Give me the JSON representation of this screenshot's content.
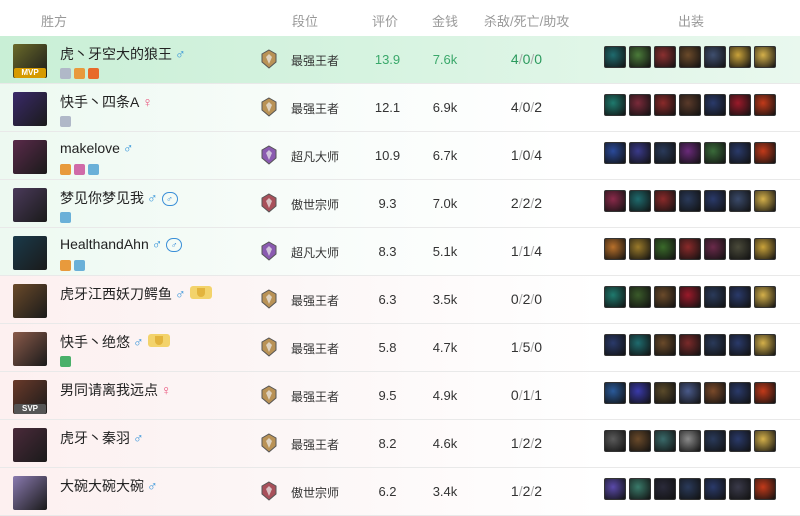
{
  "headers": {
    "team": "胜方",
    "rank": "段位",
    "score": "评价",
    "gold": "金钱",
    "kda": "杀敌/死亡/助攻",
    "items": "出装"
  },
  "players": [
    {
      "name": "虎丶牙空大的狼王",
      "gender": "♂",
      "gender_class": "male",
      "tag": "MVP",
      "tag_class": "m",
      "avatar_color": "#6a6a2a",
      "rank": "最强王者",
      "rank_color": "#b99256",
      "score": "13.9",
      "gold": "7.6k",
      "k": "4",
      "d": "0",
      "a": "0",
      "friend": false,
      "trophy": false,
      "badges": [
        "#b0b8c8",
        "#e89a3c",
        "#e86a2a"
      ],
      "items": [
        "#1f6b6e",
        "#4b7b3a",
        "#8a3030",
        "#6b4a2a",
        "#3f4f6f",
        "#c9a23a",
        "#d4b04a"
      ]
    },
    {
      "name": "快手丶四条A",
      "gender": "♀",
      "gender_class": "female",
      "tag": "",
      "tag_class": "",
      "avatar_color": "#3a2a6a",
      "rank": "最强王者",
      "rank_color": "#b99256",
      "score": "12.1",
      "gold": "6.9k",
      "k": "4",
      "d": "0",
      "a": "2",
      "friend": false,
      "trophy": false,
      "badges": [
        "#b0b8c8"
      ],
      "items": [
        "#1f7a6e",
        "#7a2a3a",
        "#8a2a2a",
        "#5a3a2a",
        "#2a3a6a",
        "#9a1a2a",
        "#c23a1a"
      ]
    },
    {
      "name": "makelove",
      "gender": "♂",
      "gender_class": "male",
      "tag": "",
      "tag_class": "",
      "avatar_color": "#5a2a4a",
      "rank": "超凡大师",
      "rank_color": "#8a5ab0",
      "score": "10.9",
      "gold": "6.7k",
      "k": "1",
      "d": "0",
      "a": "4",
      "friend": false,
      "trophy": false,
      "badges": [
        "#e89a3c",
        "#d06aa8",
        "#6ab0d8"
      ],
      "items": [
        "#2a4a9a",
        "#3a3a8a",
        "#2a3a5a",
        "#6a2a7a",
        "#3a6a3a",
        "#2a3a6a",
        "#c23a1a"
      ]
    },
    {
      "name": "梦见你梦见我",
      "gender": "♂",
      "gender_class": "male",
      "tag": "",
      "tag_class": "",
      "avatar_color": "#4a3a5a",
      "rank": "傲世宗师",
      "rank_color": "#a8505a",
      "score": "9.3",
      "gold": "7.0k",
      "k": "2",
      "d": "2",
      "a": "2",
      "friend": true,
      "trophy": false,
      "badges": [
        "#6ab0d8"
      ],
      "items": [
        "#8a2a4a",
        "#1f6b6e",
        "#8a2a2a",
        "#2a3a5a",
        "#2a3a6a",
        "#3a4a6a",
        "#d4b04a"
      ]
    },
    {
      "name": "HealthandAhn",
      "gender": "♂",
      "gender_class": "male",
      "tag": "",
      "tag_class": "",
      "avatar_color": "#1a3a4a",
      "rank": "超凡大师",
      "rank_color": "#8a5ab0",
      "score": "8.3",
      "gold": "5.1k",
      "k": "1",
      "d": "1",
      "a": "4",
      "friend": true,
      "trophy": false,
      "badges": [
        "#e89a3c",
        "#6ab0d8"
      ],
      "items": [
        "#b8702a",
        "#9a7a2a",
        "#3a6a2a",
        "#8a2a2a",
        "#6a2a4a",
        "#4a4a3a",
        "#c9a23a"
      ]
    },
    {
      "name": "虎牙江西妖刀鳄鱼",
      "gender": "♂",
      "gender_class": "male",
      "tag": "",
      "tag_class": "",
      "avatar_color": "#6a4a2a",
      "rank": "最强王者",
      "rank_color": "#b99256",
      "score": "6.3",
      "gold": "3.5k",
      "k": "0",
      "d": "2",
      "a": "0",
      "friend": false,
      "trophy": true,
      "badges": [],
      "items": [
        "#1f7a6e",
        "#3a5a2a",
        "#6a4a2a",
        "#9a1a2a",
        "#2a3a5a",
        "#2a3a6a",
        "#d4b04a"
      ]
    },
    {
      "name": "快手丶绝悠",
      "gender": "♂",
      "gender_class": "male",
      "tag": "",
      "tag_class": "",
      "avatar_color": "#8a5a4a",
      "rank": "最强王者",
      "rank_color": "#b99256",
      "score": "5.8",
      "gold": "4.7k",
      "k": "1",
      "d": "5",
      "a": "0",
      "friend": false,
      "trophy": true,
      "badges": [
        "#4ab06a"
      ],
      "items": [
        "#2a3a6a",
        "#1f6b6e",
        "#6a4a2a",
        "#7a2a2a",
        "#2a3a5a",
        "#2a3a6a",
        "#d4b04a"
      ]
    },
    {
      "name": "男同请离我远点",
      "gender": "♀",
      "gender_class": "female",
      "tag": "SVP",
      "tag_class": "s",
      "avatar_color": "#6a3a2a",
      "rank": "最强王者",
      "rank_color": "#b99256",
      "score": "9.5",
      "gold": "4.9k",
      "k": "0",
      "d": "1",
      "a": "1",
      "friend": false,
      "trophy": false,
      "badges": [],
      "items": [
        "#2a5a9a",
        "#3a3aaa",
        "#5a4a2a",
        "#4a5a8a",
        "#7a4a2a",
        "#2a3a6a",
        "#c23a1a"
      ]
    },
    {
      "name": "虎牙丶秦羽",
      "gender": "♂",
      "gender_class": "male",
      "tag": "",
      "tag_class": "",
      "avatar_color": "#4a2a3a",
      "rank": "最强王者",
      "rank_color": "#b99256",
      "score": "8.2",
      "gold": "4.6k",
      "k": "1",
      "d": "2",
      "a": "2",
      "friend": false,
      "trophy": false,
      "badges": [],
      "items": [
        "#5a5a5a",
        "#6a4a2a",
        "#3a6a6a",
        "#8a8a8a",
        "#2a3a5a",
        "#2a3a6a",
        "#d4b04a"
      ]
    },
    {
      "name": "大碗大碗大碗",
      "gender": "♂",
      "gender_class": "male",
      "tag": "",
      "tag_class": "",
      "avatar_color": "#8a7ab0",
      "rank": "傲世宗师",
      "rank_color": "#a8505a",
      "score": "6.2",
      "gold": "3.4k",
      "k": "1",
      "d": "2",
      "a": "2",
      "friend": false,
      "trophy": false,
      "badges": [],
      "items": [
        "#5a4aaa",
        "#3a7a6a",
        "#2a2a3a",
        "#2a3a5a",
        "#2a3a6a",
        "#3a3a4a",
        "#c23a1a"
      ]
    }
  ]
}
